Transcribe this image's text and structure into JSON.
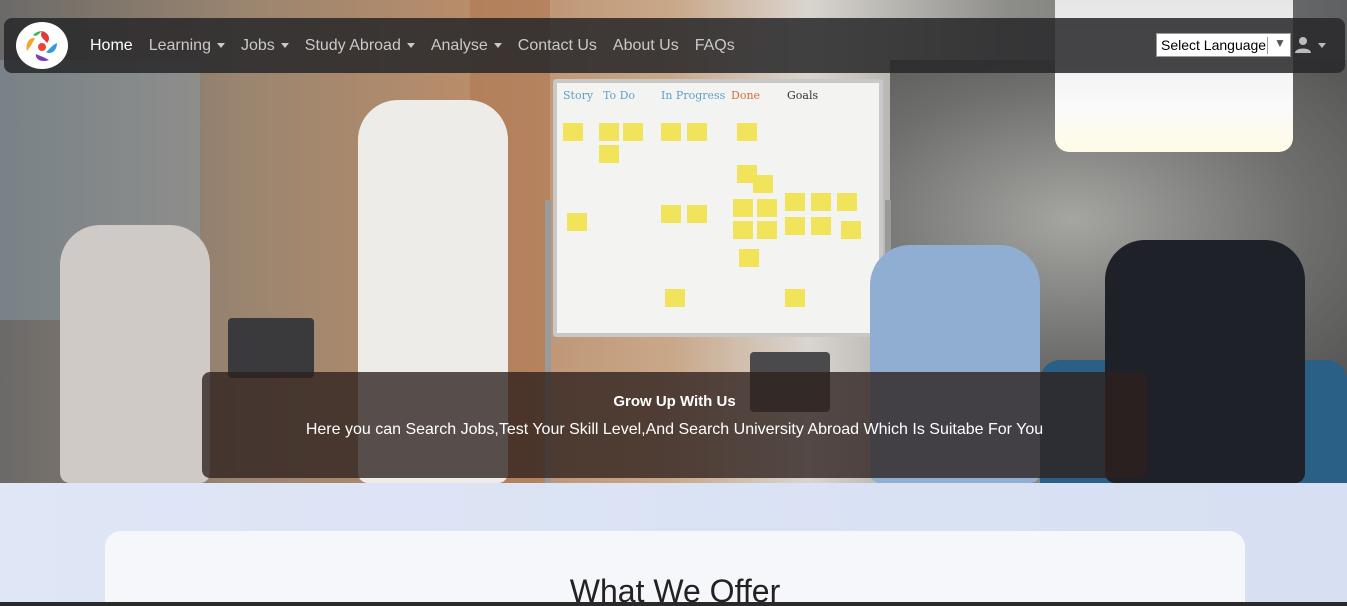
{
  "navbar": {
    "items": [
      {
        "label": "Home",
        "active": true,
        "dropdown": false
      },
      {
        "label": "Learning",
        "active": false,
        "dropdown": true
      },
      {
        "label": "Jobs",
        "active": false,
        "dropdown": true
      },
      {
        "label": "Study Abroad",
        "active": false,
        "dropdown": true
      },
      {
        "label": "Analyse",
        "active": false,
        "dropdown": true
      },
      {
        "label": "Contact Us",
        "active": false,
        "dropdown": false
      },
      {
        "label": "About Us",
        "active": false,
        "dropdown": false
      },
      {
        "label": "FAQs",
        "active": false,
        "dropdown": false
      }
    ],
    "language_select": "Select Language",
    "language_arrow": "▼",
    "user_icon": "user-icon"
  },
  "hero": {
    "caption_title": "Grow Up With Us",
    "caption_text": "Here you can Search Jobs,Test Your Skill Level,And Search University Abroad Which Is Suitabe For You",
    "whiteboard_columns": [
      "Story",
      "To Do",
      "In Progress",
      "Done",
      "Goals"
    ]
  },
  "section": {
    "title": "What We Offer"
  },
  "colors": {
    "navbar_bg": "#28282a",
    "nav_active": "#ffffff",
    "nav_text": "#c9c9c9",
    "section_bg": "#dce5f5"
  }
}
